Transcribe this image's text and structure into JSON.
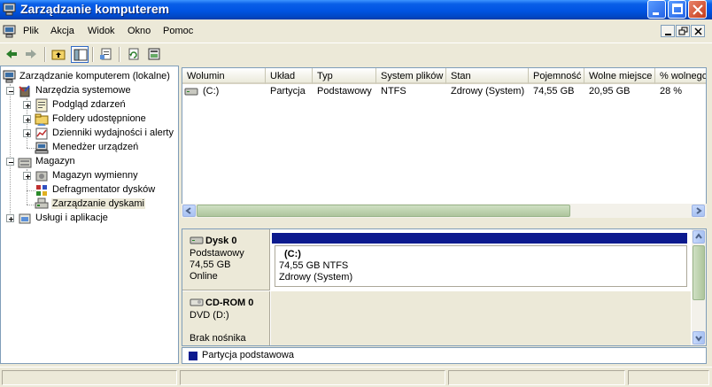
{
  "window": {
    "title": "Zarządzanie komputerem"
  },
  "menu": {
    "items": [
      "Plik",
      "Akcja",
      "Widok",
      "Okno",
      "Pomoc"
    ]
  },
  "toolbar": {
    "buttons": [
      "back-arrow-icon",
      "forward-arrow-icon",
      "up-folder-icon",
      "show-hide-tree-icon",
      "properties-icon",
      "refresh-icon",
      "help-icon"
    ]
  },
  "tree": {
    "root": "Zarządzanie komputerem (lokalne)",
    "nodes": [
      {
        "label": "Narzędzia systemowe",
        "level": 1,
        "expanded": true
      },
      {
        "label": "Podgląd zdarzeń",
        "level": 2,
        "expanded": false
      },
      {
        "label": "Foldery udostępnione",
        "level": 2,
        "expanded": false
      },
      {
        "label": "Dzienniki wydajności i alerty",
        "level": 2,
        "expanded": false
      },
      {
        "label": "Menedżer urządzeń",
        "level": 2,
        "leaf": true
      },
      {
        "label": "Magazyn",
        "level": 1,
        "expanded": true
      },
      {
        "label": "Magazyn wymienny",
        "level": 2,
        "expanded": false
      },
      {
        "label": "Defragmentator dysków",
        "level": 2,
        "leaf": true
      },
      {
        "label": "Zarządzanie dyskami",
        "level": 2,
        "leaf": true,
        "selected": true
      },
      {
        "label": "Usługi i aplikacje",
        "level": 1,
        "expanded": false
      }
    ]
  },
  "volume_list": {
    "columns": [
      "Wolumin",
      "Układ",
      "Typ",
      "System plików",
      "Stan",
      "Pojemność",
      "Wolne miejsce",
      "% wolnego"
    ],
    "rows": [
      [
        "(C:)",
        "Partycja",
        "Podstawowy",
        "NTFS",
        "Zdrowy (System)",
        "74,55 GB",
        "20,95 GB",
        "28 %"
      ]
    ]
  },
  "disks": [
    {
      "name": "Dysk 0",
      "type": "Podstawowy",
      "size": "74,55 GB",
      "status": "Online",
      "volume": {
        "label": "(C:)",
        "size_fs": "74,55 GB NTFS",
        "status": "Zdrowy (System)"
      }
    },
    {
      "name": "CD-ROM 0",
      "type": "DVD (D:)",
      "status": "Brak nośnika"
    }
  ],
  "legend": {
    "color": "#0c1a8e",
    "label": "Partycja podstawowa"
  }
}
